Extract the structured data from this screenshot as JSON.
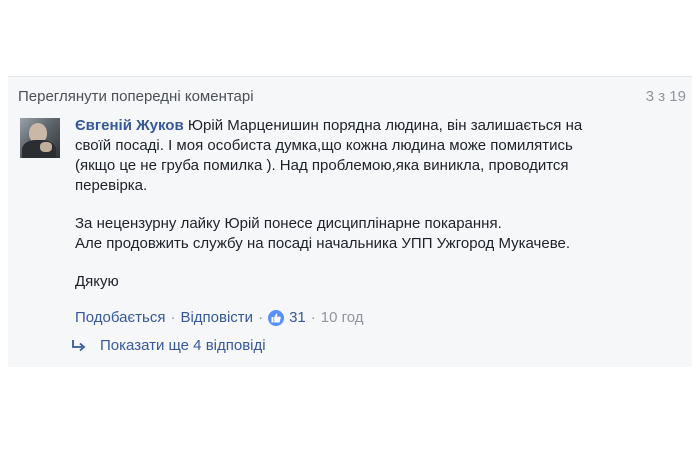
{
  "header": {
    "prev_comments_link": "Переглянути попередні коментарі",
    "counter": "3 з 19"
  },
  "comment": {
    "author": "Євгеній Жуков",
    "lines": [
      "Юрій Марценишин порядна людина, він залишається на",
      "своїй посаді. І моя особиста думка,що кожна людина може помилятись",
      "(якщо це не груба помилка ). Над проблемою,яка виникла, проводится",
      "перевірка."
    ],
    "paragraph2": [
      "За нецензурну лайку Юрій понесе дисциплінарне покарання.",
      "Але продовжить службу на посаді начальника УПП Ужгород Мукачеве."
    ],
    "paragraph3": "Дякую"
  },
  "actions": {
    "like": "Подобається",
    "reply": "Відповісти",
    "like_count": "31",
    "time": "10 год"
  },
  "replies": {
    "label": "Показати ще 4 відповіді"
  },
  "colors": {
    "link_blue": "#365899",
    "meta_gray": "#90949c",
    "text": "#1d2129",
    "panel_bg": "#f6f7f9",
    "like_badge": "#5890ff"
  }
}
